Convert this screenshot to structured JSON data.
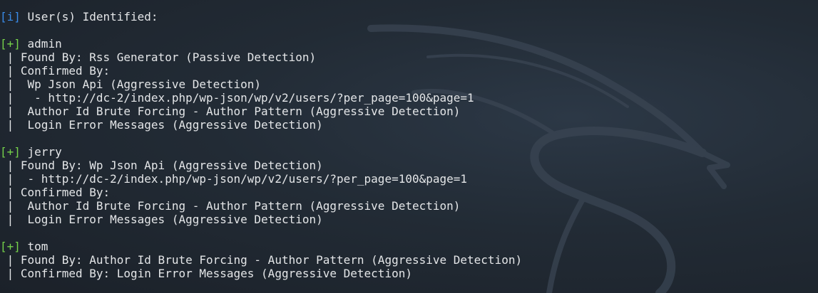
{
  "colors": {
    "background": "#222b35",
    "text": "#e4e6e8",
    "info_tag": "#3a8be8",
    "plus_tag": "#75d14a"
  },
  "header": {
    "tag": "[i]",
    "text": " User(s) Identified:"
  },
  "users": [
    {
      "tag": "[+]",
      "name": " admin",
      "lines": [
        " | Found By: Rss Generator (Passive Detection)",
        " | Confirmed By:",
        " |  Wp Json Api (Aggressive Detection)",
        " |   - http://dc-2/index.php/wp-json/wp/v2/users/?per_page=100&page=1",
        " |  Author Id Brute Forcing - Author Pattern (Aggressive Detection)",
        " |  Login Error Messages (Aggressive Detection)"
      ]
    },
    {
      "tag": "[+]",
      "name": " jerry",
      "lines": [
        " | Found By: Wp Json Api (Aggressive Detection)",
        " |  - http://dc-2/index.php/wp-json/wp/v2/users/?per_page=100&page=1",
        " | Confirmed By:",
        " |  Author Id Brute Forcing - Author Pattern (Aggressive Detection)",
        " |  Login Error Messages (Aggressive Detection)"
      ]
    },
    {
      "tag": "[+]",
      "name": " tom",
      "lines": [
        " | Found By: Author Id Brute Forcing - Author Pattern (Aggressive Detection)",
        " | Confirmed By: Login Error Messages (Aggressive Detection)"
      ]
    }
  ]
}
